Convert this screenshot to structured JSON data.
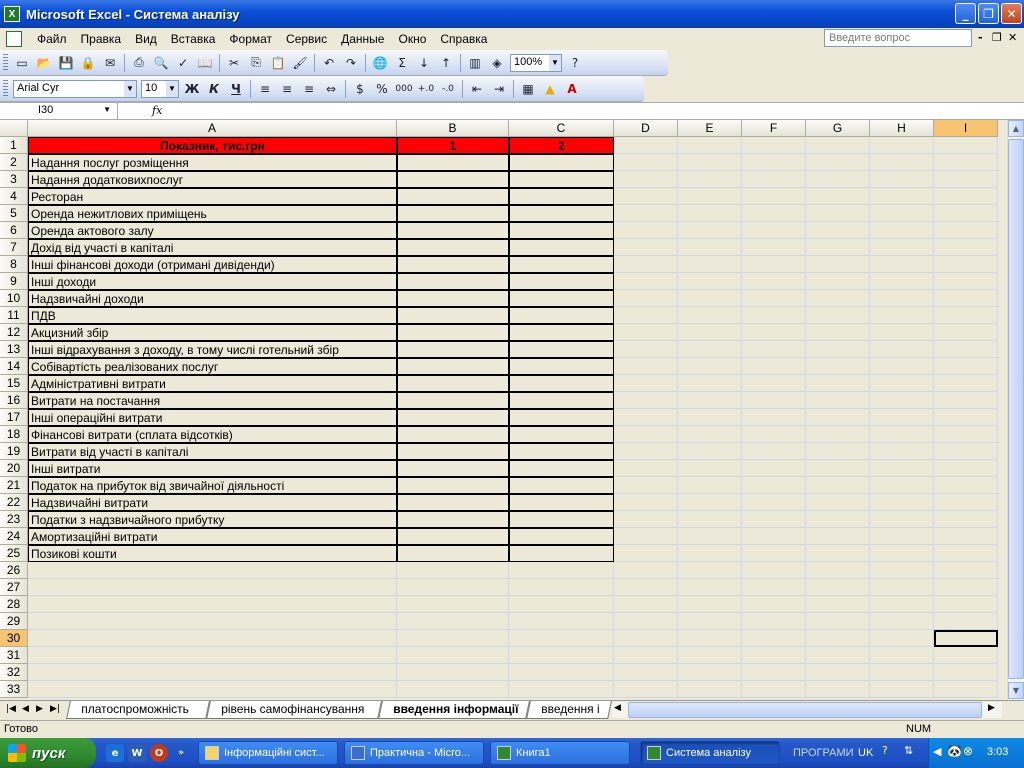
{
  "window": {
    "title": "Microsoft Excel - Система аналізу"
  },
  "menu": {
    "items": [
      "Файл",
      "Правка",
      "Вид",
      "Вставка",
      "Формат",
      "Сервис",
      "Данные",
      "Окно",
      "Справка"
    ],
    "help_placeholder": "Введите вопрос"
  },
  "toolbar": {
    "zoom": "100%",
    "font_name": "Arial Cyr",
    "font_size": "10",
    "bold": "Ж",
    "italic": "К",
    "underline": "Ч",
    "autosum": "Σ",
    "percent": "%",
    "thousands": "000"
  },
  "formula_bar": {
    "name_box": "I30",
    "fx": "fx",
    "formula": ""
  },
  "columns": [
    "A",
    "B",
    "C",
    "D",
    "E",
    "F",
    "G",
    "H",
    "I"
  ],
  "header_row": {
    "label": "Показник, тис.грн",
    "b": "1",
    "c": "2"
  },
  "rows": [
    "Надання послуг розміщення",
    "Надання додатковихпослуг",
    "Ресторан",
    "Оренда нежитлових приміщень",
    "Оренда актового залу",
    "Дохід від участі в капіталі",
    "Інші фінансові доходи (отримані дивіденди)",
    "Інші доходи",
    "Надзвичайні доходи",
    "ПДВ",
    "Акцизний збір",
    "Інші відрахування з доходу, в тому числі готельний збір",
    "Собівартість реалізованих послуг",
    "Адміністративні витрати",
    "Витрати на постачання",
    "Інші операційні витрати",
    "Фінансові витрати (сплата відсотків)",
    "Витрати від участі в капіталі",
    "Інші витрати",
    "Податок на прибуток від звичайної діяльності",
    "Надзвичайні витрати",
    "Податки з надзвичайного прибутку",
    "Амортизаційні витрати",
    "Позикові кошти"
  ],
  "row_numbers": [
    "1",
    "2",
    "3",
    "4",
    "5",
    "6",
    "7",
    "8",
    "9",
    "10",
    "11",
    "12",
    "13",
    "14",
    "15",
    "16",
    "17",
    "18",
    "19",
    "20",
    "21",
    "22",
    "23",
    "24",
    "25",
    "26",
    "27",
    "28",
    "29",
    "30",
    "31",
    "32",
    "33"
  ],
  "sheet_tabs": [
    "платоспроможність",
    "рівень самофінансування",
    "введення інформації",
    "введення і"
  ],
  "active_tab": "введення інформації",
  "status": {
    "left": "Готово",
    "num": "NUM"
  },
  "taskbar": {
    "start": "пуск",
    "tasks": [
      "Інформаційні сист...",
      "Практична - Micro...",
      "Книга1",
      "Система аналізу"
    ],
    "programs": "ПРОГРАМИ",
    "lang": "UK",
    "clock": "3:03"
  },
  "colors": {
    "header_fill": "#ff0000",
    "selected_header": "#f8c471",
    "title_bar": "#0a4fd6",
    "start_button": "#2f8a2f"
  }
}
